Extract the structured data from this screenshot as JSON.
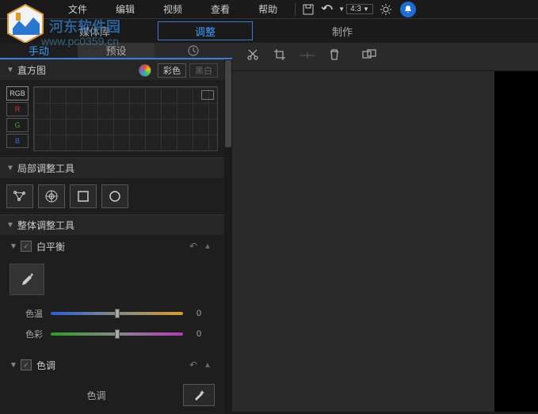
{
  "menu": {
    "file": "文件",
    "edit": "编辑",
    "video": "视频",
    "view": "查看",
    "help": "帮助",
    "ratio": "4:3"
  },
  "topnav": {
    "library": "媒体库",
    "adjust": "调整",
    "create": "制作"
  },
  "tabs": {
    "manual": "手动",
    "preset": "预设"
  },
  "histogram": {
    "title": "直方图",
    "color": "彩色",
    "bw": "黑白",
    "ch_rgb": "RGB",
    "ch_r": "R",
    "ch_g": "G",
    "ch_b": "B"
  },
  "local_tools": {
    "title": "局部调整工具"
  },
  "global_tools": {
    "title": "整体调整工具"
  },
  "white_balance": {
    "title": "白平衡",
    "temp_label": "色温",
    "tint_label": "色彩",
    "temp_value": "0",
    "tint_value": "0"
  },
  "tone": {
    "title": "色调",
    "label": "色调"
  },
  "watermark": {
    "site": "河东软件园",
    "url": "www.pc0359.cn",
    "big": "软件园"
  }
}
